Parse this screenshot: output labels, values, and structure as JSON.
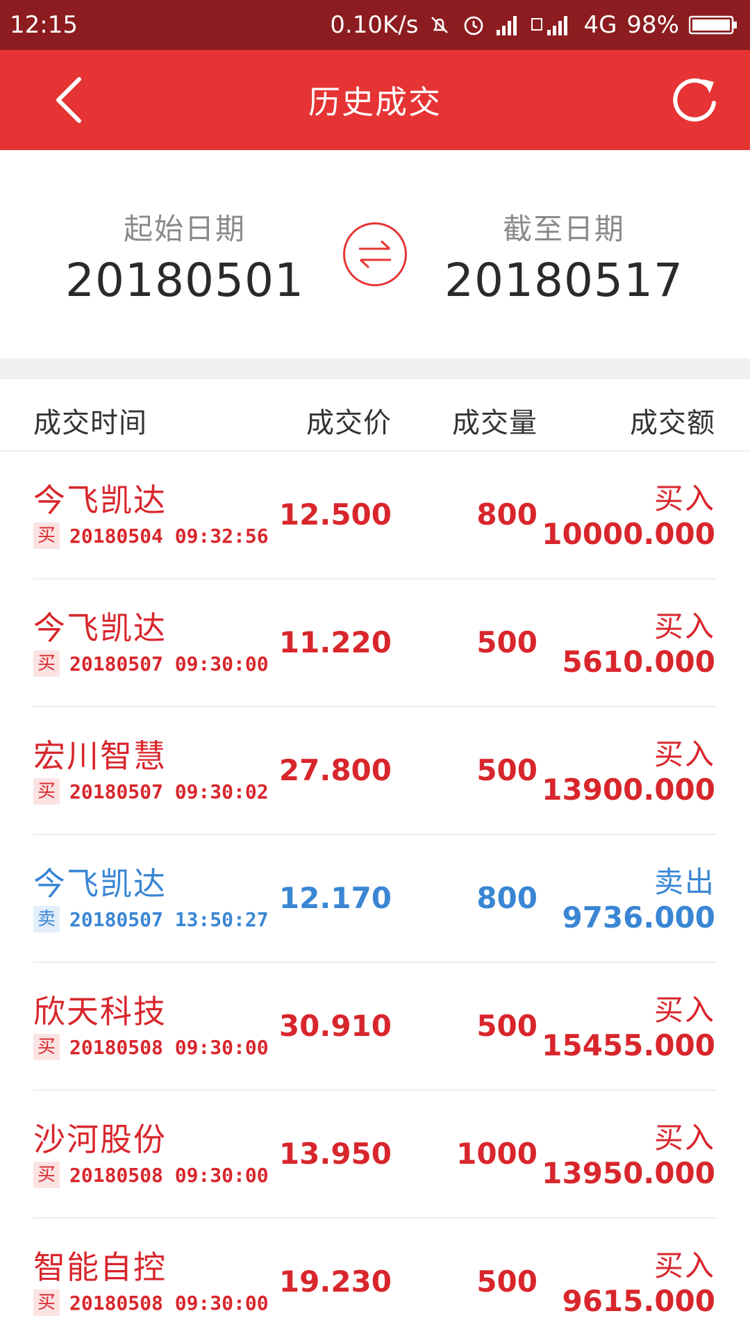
{
  "status_bar": {
    "time": "12:15",
    "net_speed": "0.10K/s",
    "network": "4G",
    "battery": "98%",
    "icons": [
      "mute-icon",
      "alarm-icon",
      "signal-icon",
      "4g-icon",
      "battery-icon"
    ]
  },
  "app_bar": {
    "title": "历史成交",
    "back_icon": "chevron-left-icon",
    "refresh_icon": "refresh-icon"
  },
  "date_range": {
    "start_label": "起始日期",
    "start_value": "20180501",
    "end_label": "截至日期",
    "end_value": "20180517",
    "swap_icon": "swap-icon"
  },
  "table": {
    "headers": {
      "time": "成交时间",
      "price": "成交价",
      "qty": "成交量",
      "amount": "成交额"
    },
    "rows": [
      {
        "name": "今飞凯达",
        "tag": "买",
        "time": "20180504 09:32:56",
        "price": "12.500",
        "qty": "800",
        "action": "买入",
        "amount": "10000.000",
        "side": "buy"
      },
      {
        "name": "今飞凯达",
        "tag": "买",
        "time": "20180507 09:30:00",
        "price": "11.220",
        "qty": "500",
        "action": "买入",
        "amount": "5610.000",
        "side": "buy"
      },
      {
        "name": "宏川智慧",
        "tag": "买",
        "time": "20180507 09:30:02",
        "price": "27.800",
        "qty": "500",
        "action": "买入",
        "amount": "13900.000",
        "side": "buy"
      },
      {
        "name": "今飞凯达",
        "tag": "卖",
        "time": "20180507 13:50:27",
        "price": "12.170",
        "qty": "800",
        "action": "卖出",
        "amount": "9736.000",
        "side": "sell"
      },
      {
        "name": "欣天科技",
        "tag": "买",
        "time": "20180508 09:30:00",
        "price": "30.910",
        "qty": "500",
        "action": "买入",
        "amount": "15455.000",
        "side": "buy"
      },
      {
        "name": "沙河股份",
        "tag": "买",
        "time": "20180508 09:30:00",
        "price": "13.950",
        "qty": "1000",
        "action": "买入",
        "amount": "13950.000",
        "side": "buy"
      },
      {
        "name": "智能自控",
        "tag": "买",
        "time": "20180508 09:30:00",
        "price": "19.230",
        "qty": "500",
        "action": "买入",
        "amount": "9615.000",
        "side": "buy"
      }
    ]
  },
  "colors": {
    "brand_red": "#e63434",
    "status_bar": "#8c1c1f",
    "buy": "#d8262c",
    "sell": "#3a86d4"
  }
}
